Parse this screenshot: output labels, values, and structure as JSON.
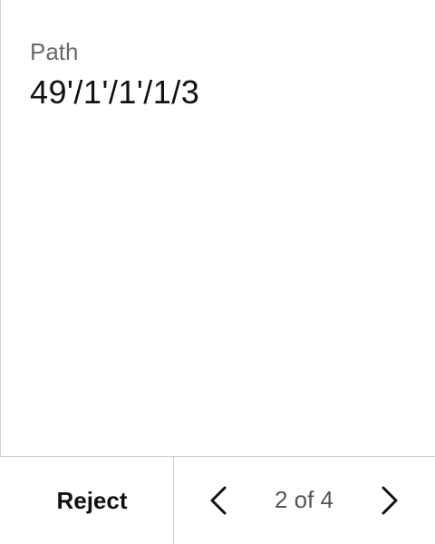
{
  "field": {
    "label": "Path",
    "value": "49'/1'/1'/1/3"
  },
  "footer": {
    "reject_label": "Reject",
    "pager": {
      "indicator": "2 of 4",
      "current_page": 2,
      "total_pages": 4,
      "prev_icon": "chevron-left-icon",
      "next_icon": "chevron-right-icon"
    }
  }
}
